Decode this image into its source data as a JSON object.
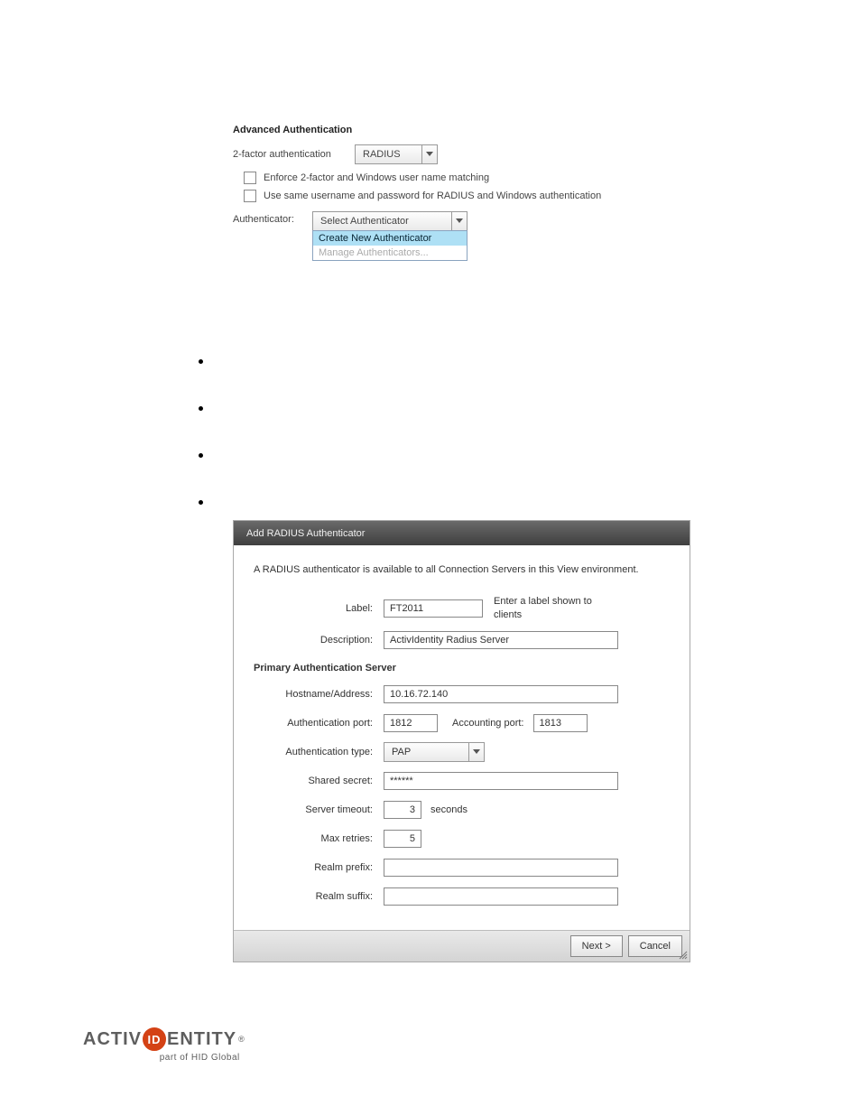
{
  "adv": {
    "title": "Advanced Authentication",
    "two_factor_label": "2-factor authentication",
    "two_factor_value": "RADIUS",
    "enforce_label": "Enforce 2-factor and Windows user name matching",
    "same_creds_label": "Use same username and password for RADIUS and Windows authentication",
    "authenticator_label": "Authenticator:",
    "authenticator_value": "Select Authenticator",
    "menu_create": "Create New Authenticator",
    "menu_manage": "Manage Authenticators..."
  },
  "dialog": {
    "title": "Add RADIUS Authenticator",
    "intro": "A RADIUS authenticator is available to all Connection Servers in this View environment.",
    "label_label": "Label:",
    "label_value": "FT2011",
    "label_hint": "Enter a label shown to clients",
    "description_label": "Description:",
    "description_value": "ActivIdentity Radius Server",
    "primary_section": "Primary Authentication Server",
    "hostname_label": "Hostname/Address:",
    "hostname_value": "10.16.72.140",
    "authport_label": "Authentication port:",
    "authport_value": "1812",
    "acctport_label": "Accounting port:",
    "acctport_value": "1813",
    "authtype_label": "Authentication type:",
    "authtype_value": "PAP",
    "secret_label": "Shared secret:",
    "secret_value": "******",
    "timeout_label": "Server timeout:",
    "timeout_value": "3",
    "timeout_unit": "seconds",
    "retries_label": "Max retries:",
    "retries_value": "5",
    "prefix_label": "Realm prefix:",
    "prefix_value": "",
    "suffix_label": "Realm suffix:",
    "suffix_value": "",
    "next_btn": "Next >",
    "cancel_btn": "Cancel"
  },
  "footer": {
    "brand_left": "ACTIV",
    "brand_mid": "ID",
    "brand_right": "ENTITY",
    "reg": "®",
    "sub": "part of HID Global"
  }
}
